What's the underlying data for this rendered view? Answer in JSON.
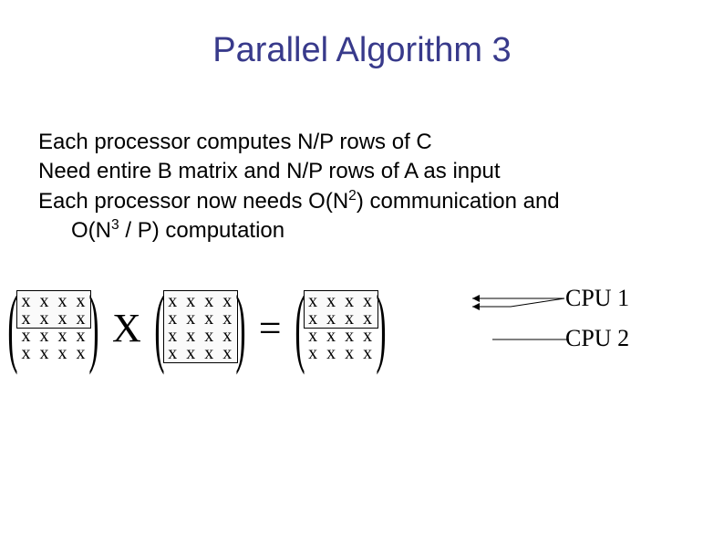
{
  "title": "Parallel Algorithm 3",
  "body": {
    "line1": "Each processor computes N/P rows of C",
    "line2": "Need entire B matrix and N/P rows of A as input",
    "line3_a": "Each processor now needs O(N",
    "line3_exp1": "2",
    "line3_b": ") communication and",
    "line4_a": "O(N",
    "line4_exp1": "3",
    "line4_b": " / P)  computation"
  },
  "operators": {
    "times": "X",
    "equals": "="
  },
  "matrix_symbols": {
    "cell": "x",
    "lparen": "(",
    "rparen": ")"
  },
  "matrices": {
    "A": {
      "rows": 4,
      "cols": 4,
      "highlight_rows": [
        0,
        1
      ]
    },
    "B": {
      "rows": 4,
      "cols": 4,
      "highlight_rows": [
        0,
        1,
        2,
        3
      ]
    },
    "C": {
      "rows": 4,
      "cols": 4,
      "highlight_rows": [
        0,
        1
      ]
    }
  },
  "cpu": {
    "label1": "CPU 1",
    "label2": "CPU 2"
  }
}
